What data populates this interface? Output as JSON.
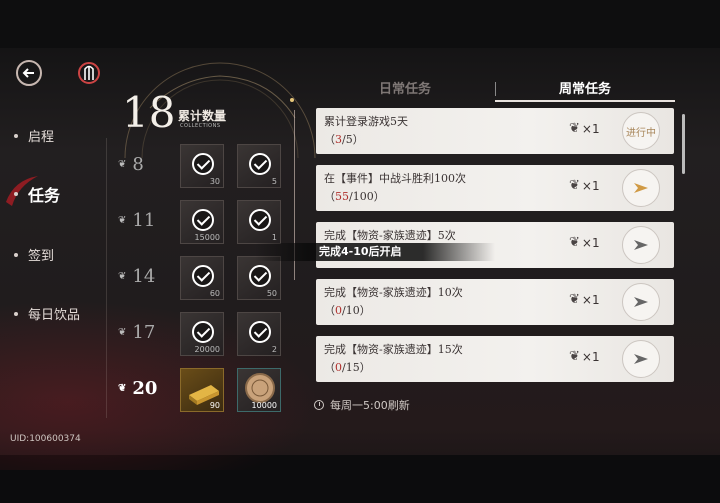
{
  "nav": {
    "items": [
      {
        "label": "启程",
        "active": false
      },
      {
        "label": "任务",
        "active": true
      },
      {
        "label": "签到",
        "active": false
      },
      {
        "label": "每日饮品",
        "active": false
      }
    ]
  },
  "user": {
    "uid": "UID:100600374"
  },
  "collection": {
    "count": "18",
    "label": "累计数量",
    "sublabel": "COLLECTIONS",
    "milestones": [
      {
        "level": "8",
        "rewards": [
          {
            "qty": "30"
          },
          {
            "qty": "5"
          }
        ],
        "claimed": true
      },
      {
        "level": "11",
        "rewards": [
          {
            "qty": "15000"
          },
          {
            "qty": "1"
          }
        ],
        "claimed": true
      },
      {
        "level": "14",
        "rewards": [
          {
            "qty": "60"
          },
          {
            "qty": "50"
          }
        ],
        "claimed": true
      },
      {
        "level": "17",
        "rewards": [
          {
            "qty": "20000"
          },
          {
            "qty": "2"
          }
        ],
        "claimed": true
      },
      {
        "level": "20",
        "rewards": [
          {
            "qty": "90"
          },
          {
            "qty": "10000"
          }
        ],
        "claimed": false
      }
    ]
  },
  "tooltip": "完成4-10后开启",
  "tabs": [
    {
      "label": "日常任务",
      "active": false
    },
    {
      "label": "周常任务",
      "active": true
    }
  ],
  "tasks": [
    {
      "title": "累计登录游戏5天",
      "current": "3",
      "total": "/5",
      "reward": "×1",
      "status": "进行中"
    },
    {
      "title": "在【事件】中战斗胜利100次",
      "current": "55",
      "total": "/100",
      "reward": "×1",
      "status": ""
    },
    {
      "title": "完成【物资-家族遗迹】5次",
      "current": "",
      "total": "",
      "reward": "×1",
      "status": ""
    },
    {
      "title": "完成【物资-家族遗迹】10次",
      "current": "0",
      "total": "/10",
      "reward": "×1",
      "status": ""
    },
    {
      "title": "完成【物资-家族遗迹】15次",
      "current": "0",
      "total": "/15",
      "reward": "×1",
      "status": ""
    }
  ],
  "refresh_text": "每周一5:00刷新",
  "colors": {
    "accent_red": "#b0302d",
    "gold": "#a8865a",
    "card_bg": "#f0ede9"
  }
}
